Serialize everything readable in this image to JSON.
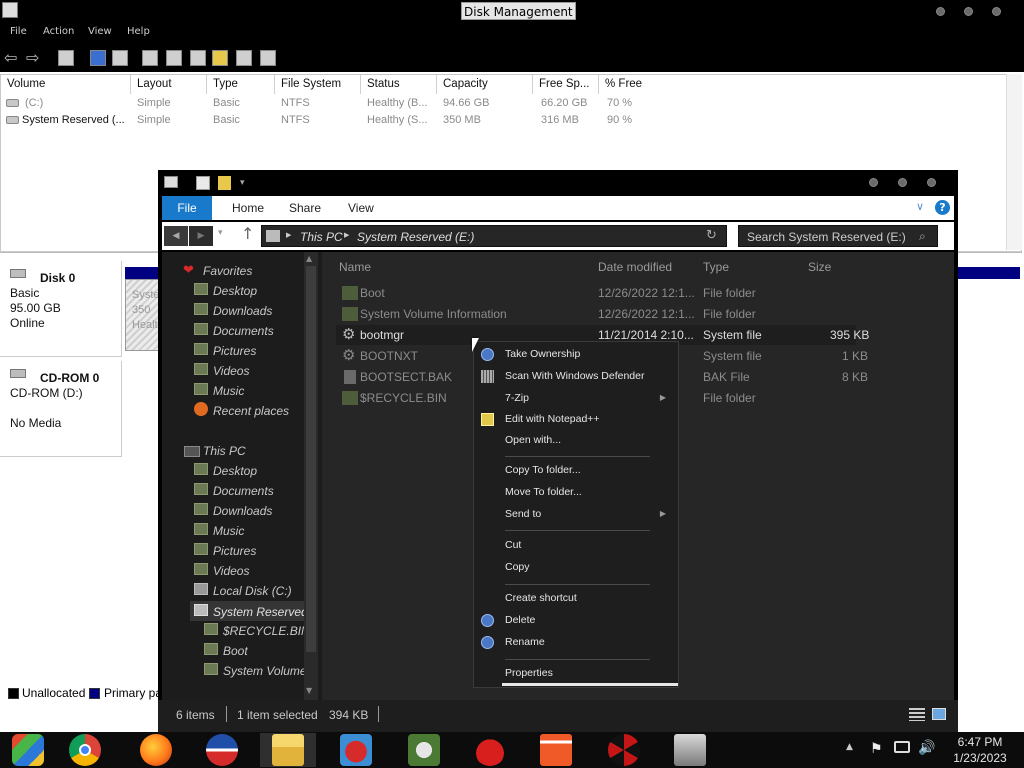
{
  "disk_management": {
    "title": "Disk Management",
    "menu": [
      "File",
      "Action",
      "View",
      "Help"
    ],
    "columns": [
      "Volume",
      "Layout",
      "Type",
      "File System",
      "Status",
      "Capacity",
      "Free Sp...",
      "% Free"
    ],
    "volumes": [
      {
        "volume": "(C:)",
        "layout": "Simple",
        "type": "Basic",
        "fs": "NTFS",
        "status": "Healthy (B...",
        "capacity": "94.66 GB",
        "free": "66.20 GB",
        "pct": "70 %"
      },
      {
        "volume": "System Reserved (...",
        "layout": "Simple",
        "type": "Basic",
        "fs": "NTFS",
        "status": "Healthy (S...",
        "capacity": "350 MB",
        "free": "316 MB",
        "pct": "90 %"
      }
    ],
    "disk0": {
      "name": "Disk 0",
      "type": "Basic",
      "size": "95.00 GB",
      "state": "Online",
      "part_name": "Syste",
      "part_size": "350",
      "part_status": "Healt"
    },
    "cdrom": {
      "name": "CD-ROM 0",
      "label": "CD-ROM (D:)",
      "media": "No Media"
    },
    "legend": {
      "unallocated": "Unallocated",
      "primary": "Primary pa"
    },
    "colors": {
      "primary": "#000080",
      "unallocated": "#000000"
    }
  },
  "explorer": {
    "tabs": {
      "file": "File",
      "home": "Home",
      "share": "Share",
      "view": "View"
    },
    "address": {
      "root": "This PC",
      "current": "System Reserved (E:)"
    },
    "search_placeholder": "Search System Reserved (E:)",
    "nav": {
      "favorites": "Favorites",
      "fav_items": [
        "Desktop",
        "Downloads",
        "Documents",
        "Pictures",
        "Videos",
        "Music",
        "Recent places"
      ],
      "this_pc": "This PC",
      "pc_items": [
        "Desktop",
        "Documents",
        "Downloads",
        "Music",
        "Pictures",
        "Videos",
        "Local Disk (C:)",
        "System Reserved ("
      ],
      "sub_items": [
        "$RECYCLE.BIN",
        "Boot",
        "System Volume"
      ]
    },
    "columns": {
      "name": "Name",
      "date": "Date modified",
      "type": "Type",
      "size": "Size"
    },
    "files": [
      {
        "name": "Boot",
        "date": "12/26/2022 12:1...",
        "type": "File folder",
        "size": "",
        "icon": "folder-icon"
      },
      {
        "name": "System Volume Information",
        "date": "12/26/2022 12:1...",
        "type": "File folder",
        "size": "",
        "icon": "folder-icon"
      },
      {
        "name": "bootmgr",
        "date": "11/21/2014 2:10...",
        "type": "System file",
        "size": "395 KB",
        "icon": "gear-icon"
      },
      {
        "name": "BOOTNXT",
        "date": "",
        "type": "System file",
        "size": "1 KB",
        "icon": "gear-icon"
      },
      {
        "name": "BOOTSECT.BAK",
        "date": "",
        "type": "BAK File",
        "size": "8 KB",
        "icon": "file-icon"
      },
      {
        "name": "$RECYCLE.BIN",
        "date": "",
        "type": "File folder",
        "size": "",
        "icon": "folder-icon"
      }
    ],
    "status": {
      "items": "6 items",
      "selected": "1 item selected",
      "size": "394 KB"
    }
  },
  "context_menu": {
    "items": [
      {
        "label": "Take Ownership",
        "icon": "shield-icon"
      },
      {
        "label": "Scan With Windows Defender",
        "icon": "defender-icon"
      },
      {
        "label": "7-Zip",
        "submenu": true
      },
      {
        "label": "Edit with Notepad++",
        "icon": "notepad-icon"
      },
      {
        "label": "Open with..."
      },
      {
        "label": "Copy To folder..."
      },
      {
        "label": "Move To folder..."
      },
      {
        "label": "Send to",
        "submenu": true
      },
      {
        "label": "Cut"
      },
      {
        "label": "Copy"
      },
      {
        "label": "Create shortcut"
      },
      {
        "label": "Delete",
        "icon": "shield-icon"
      },
      {
        "label": "Rename",
        "icon": "shield-icon"
      },
      {
        "label": "Properties"
      }
    ]
  },
  "taskbar": {
    "apps": [
      "windows-start",
      "chrome",
      "firefox",
      "obama-icon",
      "file-explorer",
      "angry-birds",
      "plant-game",
      "red-bird",
      "torii-gate",
      "radiation",
      "archive-tool"
    ],
    "time": "6:47 PM",
    "date": "1/23/2023"
  }
}
